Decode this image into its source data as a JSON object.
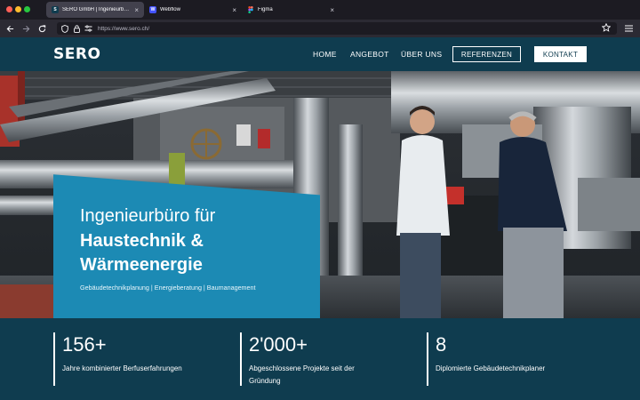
{
  "browser": {
    "tabs": [
      {
        "title": "SERO GmbH | Ingenieurbüro für",
        "favicon": "sero-favicon",
        "active": true
      },
      {
        "title": "Webflow",
        "favicon": "webflow-favicon",
        "active": false
      },
      {
        "title": "Figma",
        "favicon": "figma-favicon",
        "active": false
      }
    ],
    "url": "https://www.sero.ch/"
  },
  "header": {
    "logo": "SERO",
    "menu": [
      "HOME",
      "ANGEBOT",
      "ÜBER UNS"
    ],
    "references_button": "REFERENZEN",
    "contact_button": "KONTAKT"
  },
  "hero": {
    "subtitle": "Ingenieurbüro für",
    "title_line1": "Haustechnik &",
    "title_line2": "Wärmeenergie",
    "services": "Gebäudetechnikplanung  |  Energieberatung  |  Baumanagement"
  },
  "stats": [
    {
      "number": "156+",
      "label": "Jahre kombinierter Berfuserfahrungen"
    },
    {
      "number": "2'000+",
      "label": "Abgeschlossene Projekte seit der Gründung"
    },
    {
      "number": "8",
      "label": "Diplomierte Gebäudetechnikplaner"
    }
  ],
  "colors": {
    "header_bg": "#0f3c4f",
    "accent_blue": "#1c8ab4",
    "stats_bg": "#0f3c4f"
  }
}
